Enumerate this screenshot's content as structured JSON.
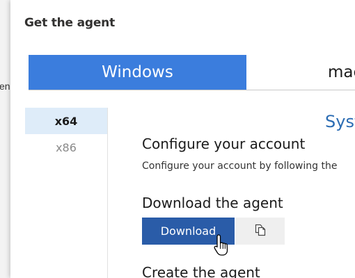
{
  "backdrop": {
    "fragment_text": "en"
  },
  "dialog": {
    "title": "Get the agent",
    "os_tabs": [
      {
        "label": "Windows",
        "active": true
      },
      {
        "label": "mac",
        "active": false
      }
    ],
    "arch_options": [
      {
        "label": "x64",
        "selected": true
      },
      {
        "label": "x86",
        "selected": false
      }
    ],
    "section_heading": "Syst",
    "configure": {
      "heading": "Configure your account",
      "description": "Configure your account by following the"
    },
    "download": {
      "heading": "Download the agent",
      "button_label": "Download",
      "copy_icon": "copy-icon"
    },
    "create": {
      "heading": "Create the agent"
    }
  },
  "colors": {
    "tab_active_bg": "#3b7ddd",
    "download_button_bg": "#2a5ca8",
    "arch_selected_bg": "#deecf9",
    "section_heading": "#2b6cb3"
  }
}
